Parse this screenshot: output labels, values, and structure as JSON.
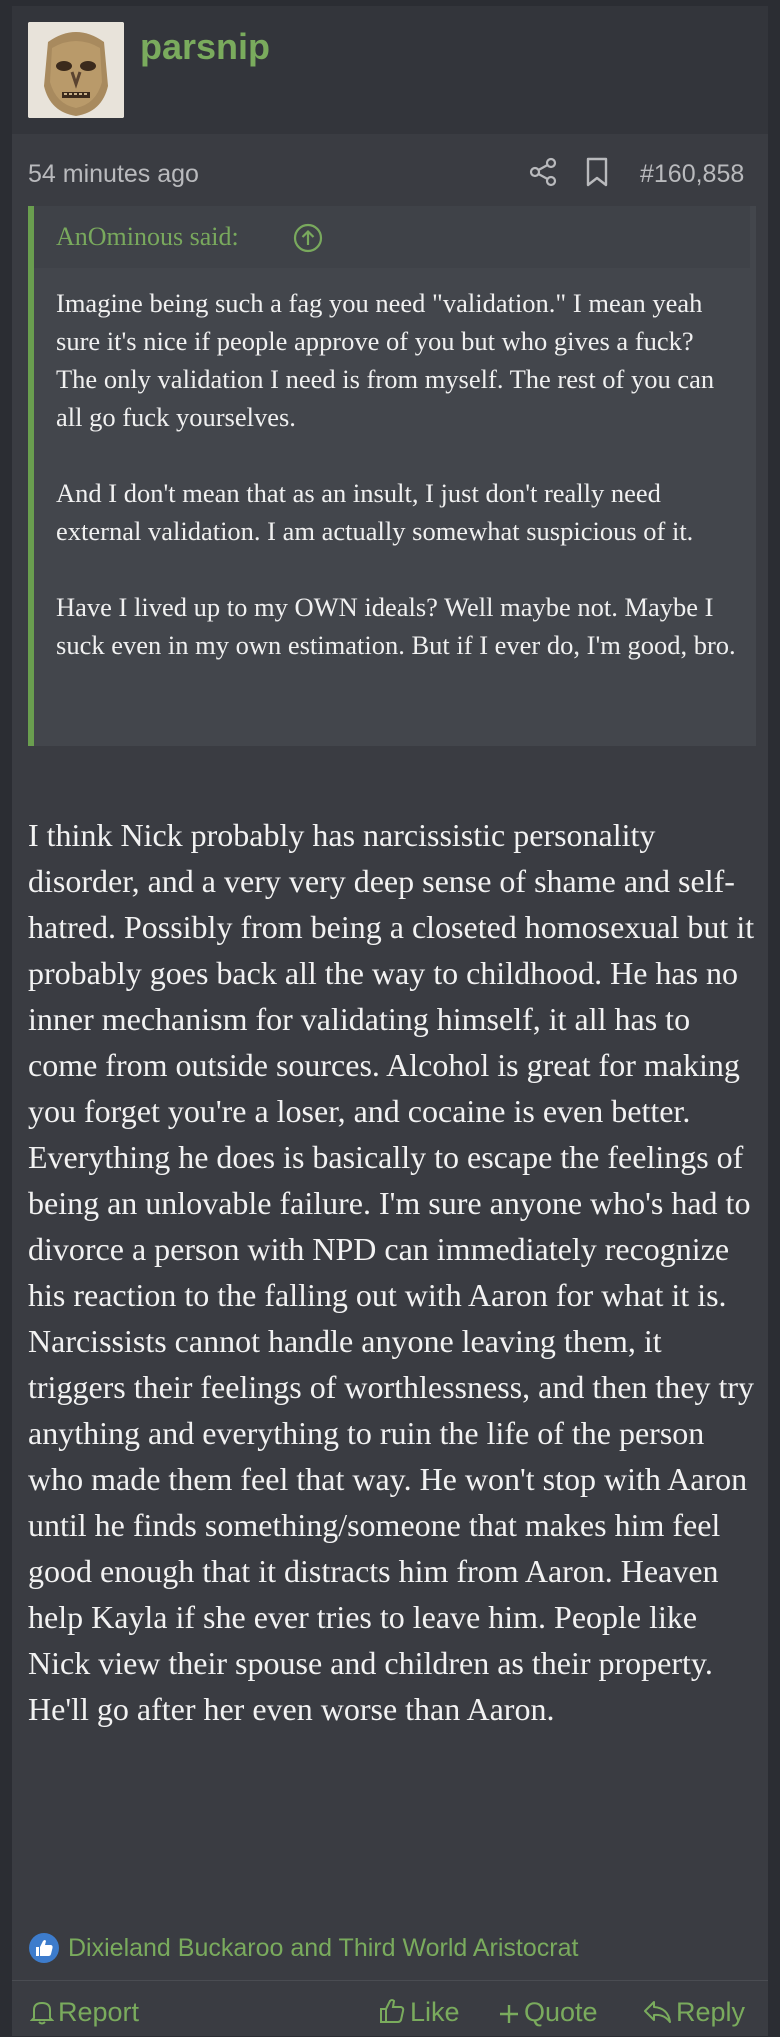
{
  "post": {
    "username": "parsnip",
    "timestamp": "54 minutes ago",
    "post_number": "#160,858",
    "quote": {
      "attribution": "AnOminous said:",
      "paragraphs": [
        "Imagine being such a fag you need \"validation.\" I mean yeah sure it's nice if people approve of you but who gives a fuck? The only validation I need is from myself. The rest of you can all go fuck yourselves.",
        "And I don't mean that as an insult, I just don't really need external validation. I am actually somewhat suspicious of it.",
        "Have I lived up to my OWN ideals? Well maybe not. Maybe I suck even in my own estimation. But if I ever do, I'm good, bro."
      ]
    },
    "message": "I think Nick probably has narcissistic personality disorder, and a very very deep sense of shame and self-hatred. Possibly from being a closeted homosexual but it probably goes back all the way to childhood. He has no inner mechanism for validating himself, it all has to come from outside sources. Alcohol is great for making you forget you're a loser, and cocaine is even better. Everything he does is basically to escape the feelings of being an unlovable failure. I'm sure anyone who's had to divorce a person with NPD can immediately recognize his reaction to the falling out with Aaron for what it is. Narcissists cannot handle anyone leaving them, it triggers their feelings of worthlessness, and then they try anything and everything to ruin the life of the person who made them feel that way. He won't stop with Aaron until he finds something/someone that makes him feel good enough that it distracts him from Aaron. Heaven help Kayla if she ever tries to leave him. People like Nick view their spouse and children as their property. He'll go after her even worse than Aaron.",
    "reactions": "Dixieland Buckaroo and Third World Aristocrat",
    "actions": {
      "report": "Report",
      "like": "Like",
      "quote": "Quote",
      "reply": "Reply"
    }
  },
  "icons": {
    "avatar": "mask-avatar",
    "share": "share-icon",
    "bookmark": "bookmark-icon",
    "quote_jump": "arrow-up-circle-icon",
    "reaction": "like-badge-icon",
    "report": "bell-icon",
    "like": "thumbs-up-icon",
    "quote": "plus-icon",
    "reply": "reply-icon"
  },
  "colors": {
    "accent": "#7aab5d",
    "background": "#2b2d33",
    "post_bg": "#3a3c42",
    "quote_bg": "#43464c"
  }
}
